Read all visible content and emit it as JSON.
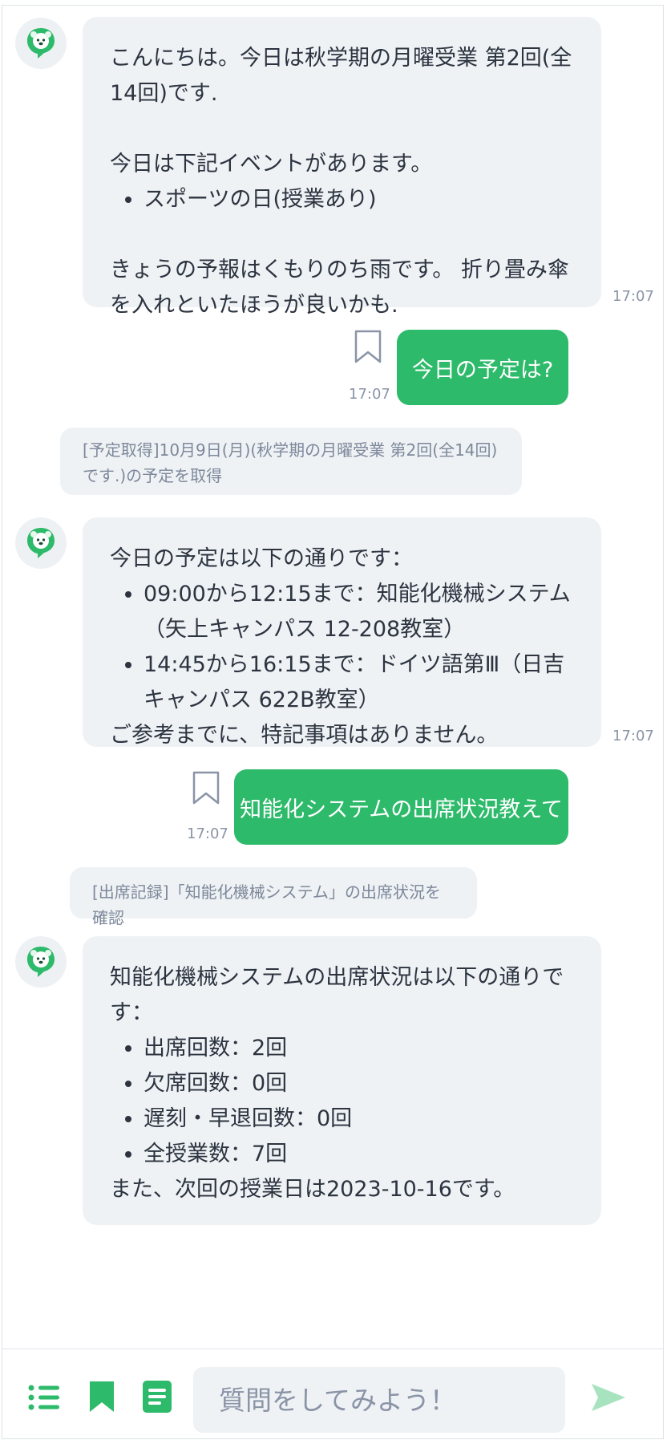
{
  "messages": {
    "m1": {
      "greeting": "こんにちは。今日は秋学期の月曜受業 第2回(全14回)です.",
      "events_intro": "今日は下記イベントがあります。",
      "events": [
        "スポーツの日(授業あり)"
      ],
      "forecast": "きょうの予報はくもりのち雨です。 折り畳み傘を入れといたほうが良いかも.",
      "time": "17:07"
    },
    "u1": {
      "text": "今日の予定は?",
      "time": "17:07"
    },
    "s1": {
      "text": "[予定取得]10月9日(月)(秋学期の月曜受業 第2回(全14回)です.)の予定を取得"
    },
    "m2": {
      "intro": "今日の予定は以下の通りです：",
      "items": [
        "09:00から12:15まで：知能化機械システム（矢上キャンパス 12-208教室）",
        "14:45から16:15まで：ドイツ語第Ⅲ（日吉キャンパス 622B教室）"
      ],
      "outro": "ご参考までに、特記事項はありません。",
      "time": "17:07"
    },
    "u2": {
      "text": "知能化システムの出席状況教えて",
      "time": "17:07"
    },
    "s2": {
      "text": "[出席記録]「知能化機械システム」の出席状況を確認"
    },
    "m3": {
      "intro": "知能化機械システムの出席状況は以下の通りです：",
      "items": [
        "出席回数：2回",
        "欠席回数：0回",
        "遅刻・早退回数：0回",
        "全授業数：7回"
      ],
      "outro": "また、次回の授業日は2023-10-16です。"
    }
  },
  "composer": {
    "placeholder": "質問をしてみよう！"
  },
  "icons": {
    "bot_avatar": "bot-avatar-icon",
    "bookmark": "bookmark-icon",
    "list": "list-icon",
    "saved": "bookmark-filled-icon",
    "notes": "notes-icon",
    "send": "send-icon"
  },
  "colors": {
    "accent": "#2dba6a",
    "bubble": "#eff2f5",
    "muted": "#8a94a6"
  }
}
